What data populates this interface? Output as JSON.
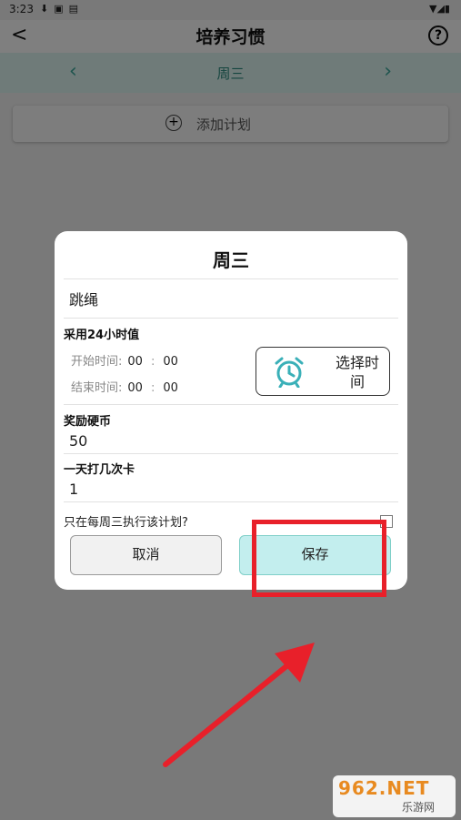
{
  "status_bar": {
    "time": "3:23"
  },
  "app_bar": {
    "title": "培养习惯"
  },
  "week_nav": {
    "day": "周三",
    "prev": "‹",
    "next": "›"
  },
  "add_plan": {
    "label": "添加计划"
  },
  "dialog": {
    "title": "周三",
    "plan_name": "跳绳",
    "use_24h_label": "采用24小时值",
    "start_time_label": "开始时间:",
    "start_hour": "00",
    "start_minute": "00",
    "end_time_label": "结束时间:",
    "end_hour": "00",
    "end_minute": "00",
    "time_separator": ":",
    "select_time_label": "选择时间",
    "reward_label": "奖励硬币",
    "reward_value": "50",
    "checkins_label": "一天打几次卡",
    "checkins_value": "1",
    "only_weekday_label": "只在每周三执行该计划?",
    "only_weekday_checked": false,
    "cancel_label": "取消",
    "save_label": "保存"
  },
  "watermark": {
    "brand": "962.NET",
    "sub": "乐游网"
  },
  "colors": {
    "accent": "#3aa89a",
    "save_bg": "#c3eeee",
    "highlight": "#e8202a"
  }
}
